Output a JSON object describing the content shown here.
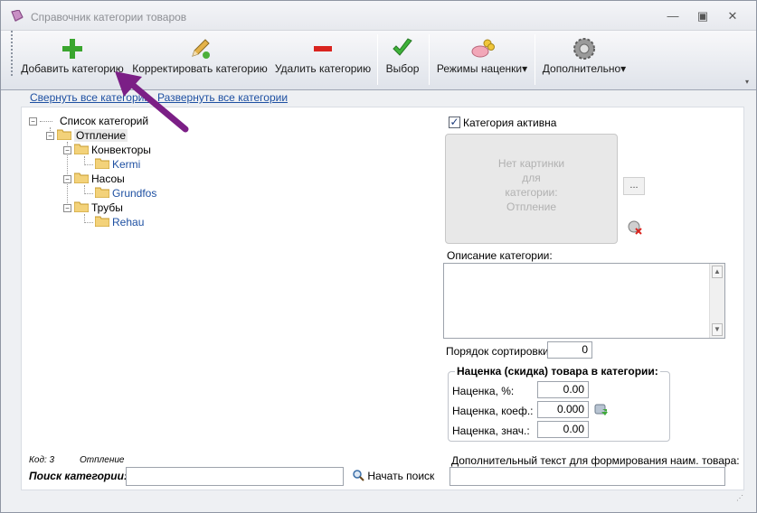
{
  "window": {
    "title": "Справочник категории товаров",
    "minimize": "—",
    "maximize": "▣",
    "close": "✕"
  },
  "toolbar": {
    "add": "Добавить категорию",
    "edit": "Корректировать категорию",
    "delete": "Удалить категорию",
    "select": "Выбор",
    "markup_modes": "Режимы наценки",
    "more": "Дополнительно",
    "dropdown_arrow": "▾"
  },
  "links": {
    "collapse": "Свернуть все категории",
    "expand": "Развернуть все категории"
  },
  "tree": {
    "root": "Список категорий",
    "expander": "−",
    "nodes": [
      {
        "label": "Отпление",
        "level": 1,
        "selected": true
      },
      {
        "label": "Конвекторы",
        "level": 2
      },
      {
        "label": "Kermi",
        "level": 3
      },
      {
        "label": "Насоы",
        "level": 2
      },
      {
        "label": "Grundfos",
        "level": 3
      },
      {
        "label": "Трубы",
        "level": 2
      },
      {
        "label": "Rehau",
        "level": 3
      }
    ]
  },
  "details": {
    "active_label": "Категория активна",
    "active_checked": true,
    "check_mark": "✓",
    "no_image_lines": [
      "Нет картинки",
      "для",
      "категории:",
      "Отпление"
    ],
    "browse_button": "...",
    "description_label": "Описание категории:",
    "scroll_up": "▲",
    "scroll_down": "▼",
    "sort_label": "Порядок сортировки:",
    "sort_value": "0",
    "markup_group": "Наценка (скидка) товара в категории:",
    "markup_pct_label": "Наценка, %:",
    "markup_pct": "0.00",
    "markup_coef_label": "Наценка, коеф.:",
    "markup_coef": "0.000",
    "markup_val_label": "Наценка, знач.:",
    "markup_val": "0.00",
    "extra_text_label": "Дополнительный текст для формирования наим. товара:"
  },
  "status": {
    "code": "Код: 3",
    "name": "Отпление"
  },
  "search": {
    "label": "Поиск категории:",
    "value": "",
    "button": "Начать поиск"
  },
  "colors": {
    "accent_link": "#1e50a2",
    "arrow": "#7b1f86",
    "plus": "#3aa52e",
    "minus": "#d9241f"
  }
}
